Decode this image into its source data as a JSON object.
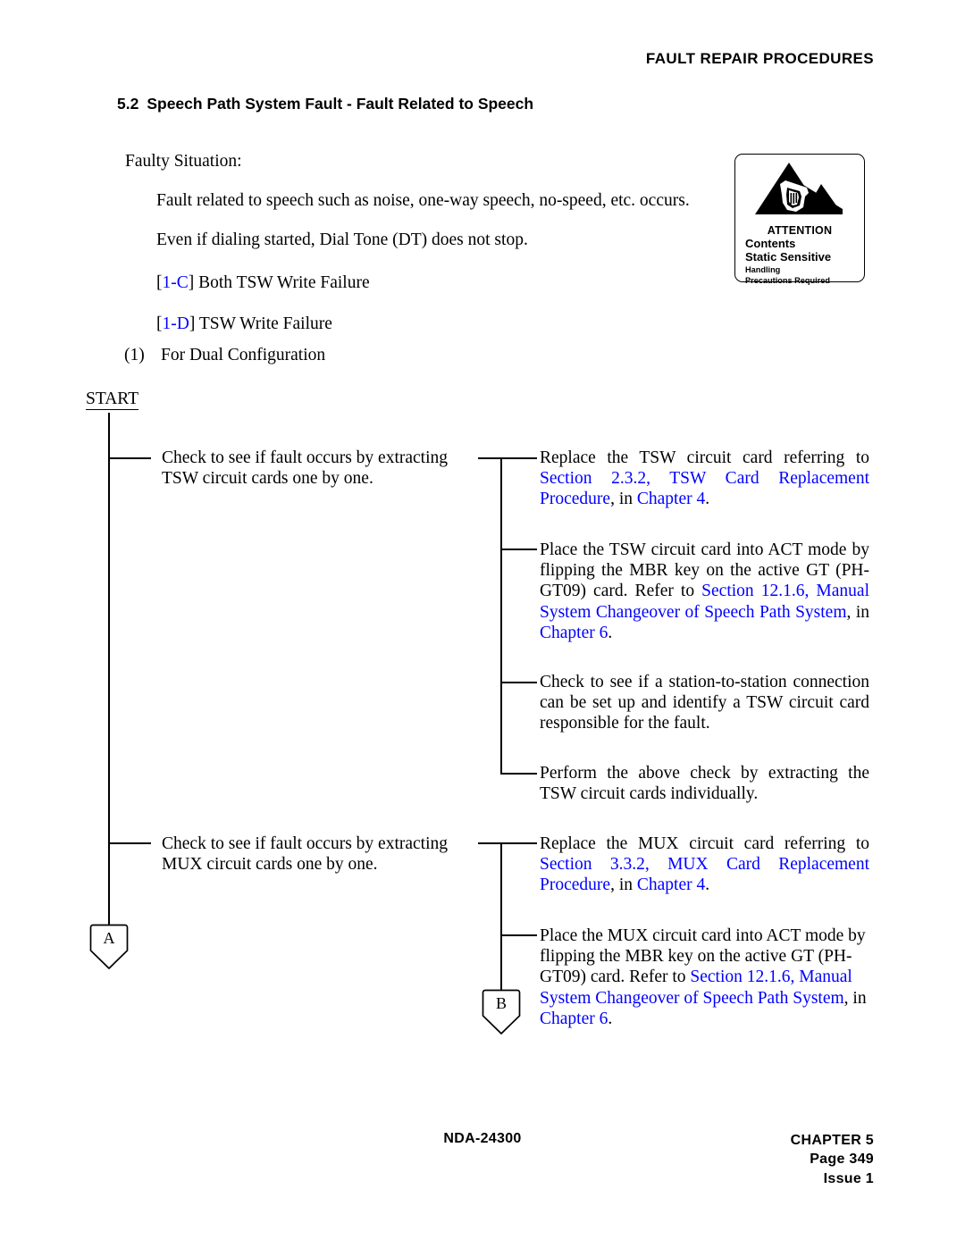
{
  "header": {
    "running_head": "FAULT REPAIR PROCEDURES"
  },
  "heading": {
    "number": "5.2",
    "title": "Speech Path System Fault - Fault Related to Speech"
  },
  "intro": {
    "label": "Faulty Situation:",
    "line1": "Fault related to speech such as noise, one-way speech, no-speed, etc. occurs.",
    "line2": "Even if dialing started, Dial Tone (DT) does not stop.",
    "item_1c_open": "[",
    "item_1c_code": "1-C",
    "item_1c_rest": "] Both TSW Write Failure",
    "item_1d_open": "[",
    "item_1d_code": "1-D",
    "item_1d_rest": "] TSW Write Failure",
    "config_number": "(1)",
    "config_label": "For Dual Configuration"
  },
  "esd_label": {
    "symbol": "esd-hand-triangle",
    "attention": "ATTENTION",
    "contents": "Contents",
    "static_sensitive": "Static Sensitive",
    "handling": "Handling",
    "precautions": "Precautions Required"
  },
  "flow": {
    "start": "START",
    "connector_a": "A",
    "connector_b": "B",
    "tsw_check": {
      "line1": "Check to see if fault occurs by extracting",
      "line2": "TSW circuit cards one by one."
    },
    "mux_check": {
      "line1": "Check to see if fault occurs by extracting",
      "line2": "MUX circuit cards one by one."
    },
    "tsw_actions": [
      {
        "name": "tsw-replace",
        "parts": [
          {
            "text": "Replace the TSW circuit card referring to ",
            "blue": false
          },
          {
            "text": "Section 2.3.2, TSW Card Replacement Procedure",
            "blue": true
          },
          {
            "text": ", in ",
            "blue": false
          },
          {
            "text": "Chapter 4",
            "blue": true
          },
          {
            "text": ".",
            "blue": false
          }
        ]
      },
      {
        "name": "tsw-act-mode",
        "parts": [
          {
            "text": "Place the TSW circuit card into ACT mode by flipping the MBR key on the active GT (PH-GT09) card. Refer to ",
            "blue": false
          },
          {
            "text": "Section 12.1.6, Manual System Changeover of Speech Path System",
            "blue": true
          },
          {
            "text": ", in ",
            "blue": false
          },
          {
            "text": "Chapter 6",
            "blue": true
          },
          {
            "text": ".",
            "blue": false
          }
        ]
      },
      {
        "name": "tsw-station-connection",
        "parts": [
          {
            "text": "Check to see if a station-to-station connection can be set up and identify a TSW circuit card responsible for the fault.",
            "blue": false
          }
        ]
      },
      {
        "name": "tsw-perform-check",
        "parts": [
          {
            "text": "Perform the above check by extracting the TSW circuit cards individually.",
            "blue": false
          }
        ]
      }
    ],
    "mux_actions": [
      {
        "name": "mux-replace",
        "parts": [
          {
            "text": "Replace the MUX circuit card referring to ",
            "blue": false
          },
          {
            "text": "Section 3.3.2, MUX Card Replacement Procedure",
            "blue": true
          },
          {
            "text": ", in ",
            "blue": false
          },
          {
            "text": "Chapter 4",
            "blue": true
          },
          {
            "text": ".",
            "blue": false
          }
        ]
      },
      {
        "name": "mux-act-mode",
        "parts": [
          {
            "text": "Place the MUX circuit card into ACT mode by flipping the MBR key on the active GT (PH-GT09) card. Refer to ",
            "blue": false
          },
          {
            "text": "Section 12.1.6, Manual System Changeover of Speech Path System",
            "blue": true
          },
          {
            "text": ", in ",
            "blue": false
          },
          {
            "text": "Chapter 6",
            "blue": true
          },
          {
            "text": ".",
            "blue": false
          }
        ]
      }
    ]
  },
  "footer": {
    "document": "NDA-24300",
    "chapter": "CHAPTER 5",
    "page": "Page 349",
    "issue": "Issue 1"
  },
  "colors": {
    "link_blue": "#0000ff",
    "text_black": "#000000"
  }
}
